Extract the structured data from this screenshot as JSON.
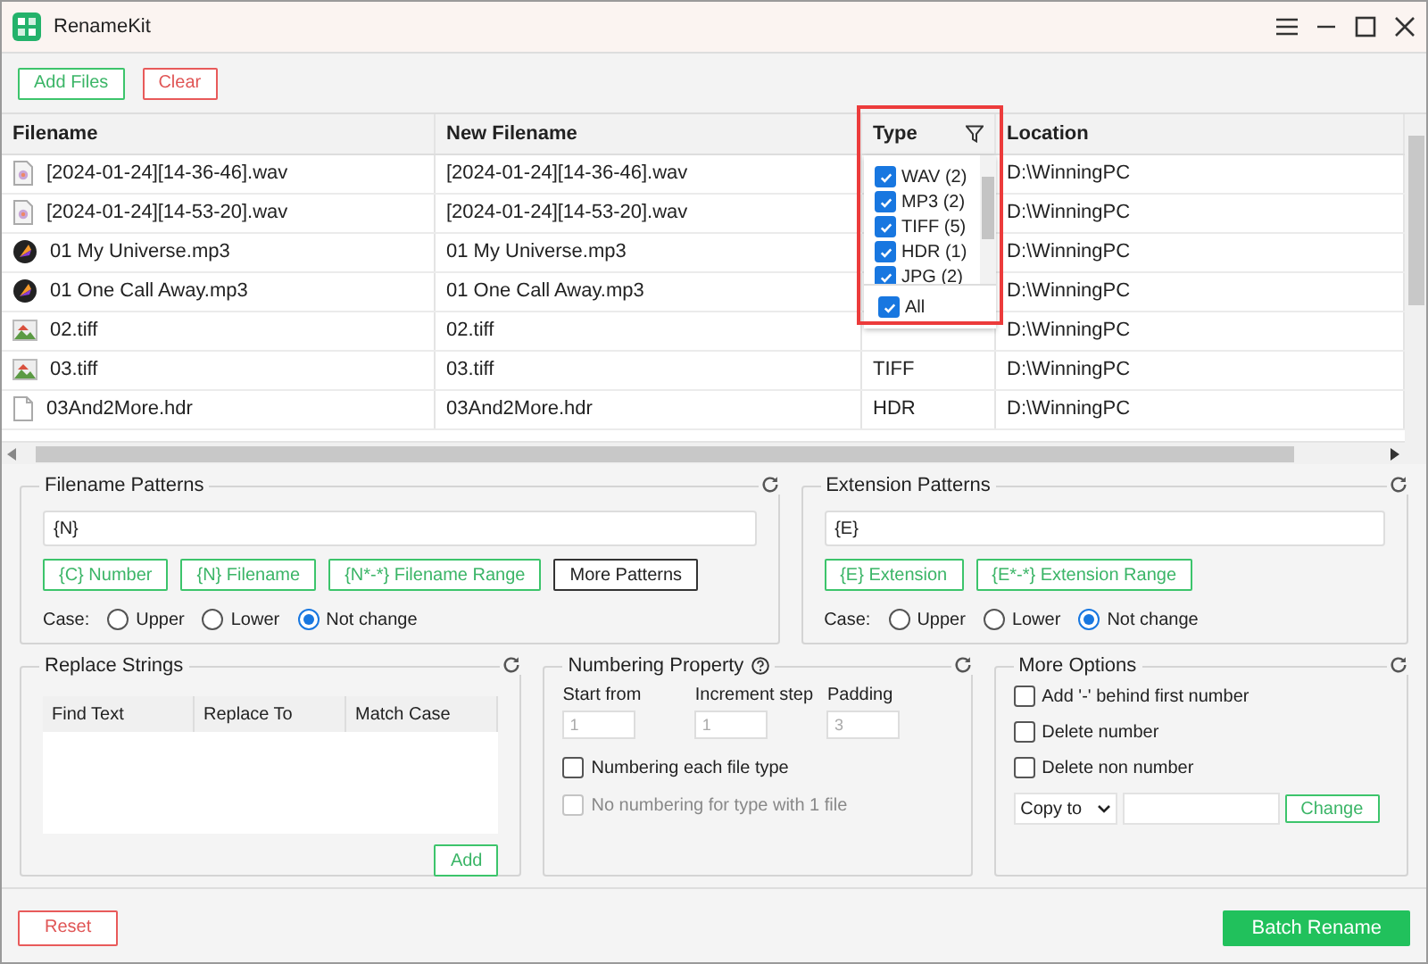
{
  "window": {
    "title": "RenameKit"
  },
  "toolbar": {
    "buttons": [
      {
        "label": "Add Files",
        "kind": "primary"
      },
      {
        "label": "Clear",
        "kind": "danger"
      }
    ]
  },
  "table": {
    "columns": [
      "Filename",
      "New Filename",
      "Type",
      "Location"
    ],
    "rows": [
      {
        "kind": "audio",
        "filename": "[2024-01-24][14-36-46].wav",
        "new_filename": "[2024-01-24][14-36-46].wav",
        "location": "D:\\WinningPC"
      },
      {
        "kind": "audio",
        "filename": "[2024-01-24][14-53-20].wav",
        "new_filename": "[2024-01-24][14-53-20].wav",
        "location": "D:\\WinningPC"
      },
      {
        "kind": "music",
        "filename": "01 My Universe.mp3",
        "new_filename": "01 My Universe.mp3",
        "location": "D:\\WinningPC"
      },
      {
        "kind": "music",
        "filename": "01 One Call Away.mp3",
        "new_filename": "01 One Call Away.mp3",
        "location": "D:\\WinningPC"
      },
      {
        "kind": "image",
        "filename": "02.tiff",
        "new_filename": "02.tiff",
        "location": "D:\\WinningPC"
      },
      {
        "kind": "image",
        "filename": "03.tiff",
        "new_filename": "03.tiff",
        "type": "TIFF",
        "location": "D:\\WinningPC"
      },
      {
        "kind": "file",
        "filename": "03And2More.hdr",
        "new_filename": "03And2More.hdr",
        "type": "HDR",
        "location": "D:\\WinningPC"
      }
    ],
    "type_filter": {
      "items": [
        {
          "label": "WAV (2)",
          "checked": true
        },
        {
          "label": "MP3 (2)",
          "checked": true
        },
        {
          "label": "TIFF (5)",
          "checked": true
        },
        {
          "label": "HDR (1)",
          "checked": true
        },
        {
          "label": "JPG (2)",
          "checked": true
        }
      ],
      "all": {
        "label": "All",
        "checked": true
      }
    }
  },
  "filename_patterns": {
    "title": "Filename Patterns",
    "value": "{N}",
    "buttons": [
      {
        "label": "{C} Number",
        "kind": "pattern"
      },
      {
        "label": "{N} Filename",
        "kind": "pattern"
      },
      {
        "label": "{N*-*} Filename Range",
        "kind": "pattern"
      },
      {
        "label": "More Patterns",
        "kind": "more"
      }
    ],
    "case_label": "Case:",
    "case_options": [
      {
        "label": "Upper",
        "selected": false
      },
      {
        "label": "Lower",
        "selected": false
      },
      {
        "label": "Not change",
        "selected": true
      }
    ]
  },
  "extension_patterns": {
    "title": "Extension Patterns",
    "value": "{E}",
    "buttons": [
      {
        "label": "{E} Extension",
        "kind": "pattern"
      },
      {
        "label": "{E*-*} Extension Range",
        "kind": "pattern"
      }
    ],
    "case_label": "Case:",
    "case_options": [
      {
        "label": "Upper",
        "selected": false
      },
      {
        "label": "Lower",
        "selected": false
      },
      {
        "label": "Not change",
        "selected": true
      }
    ]
  },
  "replace_strings": {
    "title": "Replace Strings",
    "columns": [
      "Find Text",
      "Replace To",
      "Match Case"
    ],
    "add": "Add"
  },
  "numbering": {
    "title": "Numbering Property",
    "fields": [
      {
        "label": "Start from",
        "value": "1",
        "disabled": true
      },
      {
        "label": "Increment step",
        "value": "1",
        "disabled": true
      },
      {
        "label": "Padding",
        "value": "3",
        "disabled": true
      }
    ],
    "options": [
      {
        "label": "Numbering each file type",
        "checked": false,
        "disabled": false
      },
      {
        "label": "No numbering for type with 1 file",
        "checked": false,
        "disabled": true
      }
    ]
  },
  "more_options": {
    "title": "More Options",
    "options": [
      {
        "label": "Add '-' behind first number",
        "checked": false
      },
      {
        "label": "Delete number",
        "checked": false
      },
      {
        "label": "Delete non number",
        "checked": false
      }
    ],
    "copy_select": "Copy to",
    "change": "Change"
  },
  "footer": {
    "reset": "Reset",
    "batch_rename": "Batch Rename"
  }
}
